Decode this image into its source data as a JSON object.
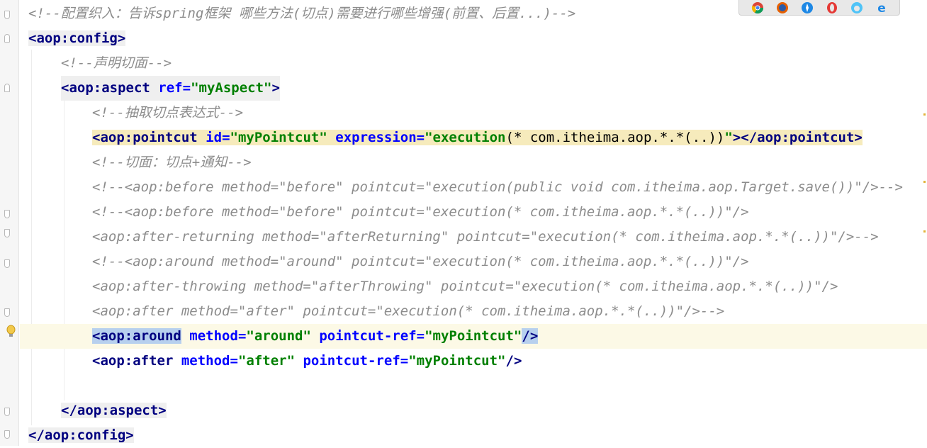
{
  "browser_icons": [
    "chrome-icon",
    "firefox-icon",
    "safari-icon",
    "opera-icon",
    "edge-icon",
    "ie-icon"
  ],
  "lines": [
    {
      "kind": "comment",
      "text": "<!--配置织入：告诉spring框架 哪些方法(切点)需要进行哪些增强(前置、后置...)-->"
    },
    {
      "kind": "open",
      "open": "<aop:config>"
    },
    {
      "kind": "comment",
      "text": "<!--声明切面-->"
    },
    {
      "kind": "tag",
      "lt": "<",
      "name": "aop:aspect",
      "attrs": [
        {
          "n": "ref",
          "v": "\"myAspect\""
        }
      ],
      "close": ">"
    },
    {
      "kind": "comment",
      "text": "<!--抽取切点表达式-->"
    },
    {
      "kind": "pointcut",
      "lt": "<",
      "name": "aop:pointcut",
      "id_attr": "id",
      "id_val": "\"myPointcut\"",
      "expr_attr": "expression",
      "expr_val_1": "\"execution",
      "expr_val_2": "(* com.itheima.aop.*.*(..))",
      "expr_val_3": "\"",
      "close": "></aop:pointcut>"
    },
    {
      "kind": "comment",
      "text": "<!--切面：切点+通知-->"
    },
    {
      "kind": "comment",
      "text": "<!--<aop:before method=\"before\" pointcut=\"execution(public void com.itheima.aop.Target.save())\"/>-->"
    },
    {
      "kind": "comment",
      "text": "<!--<aop:before method=\"before\" pointcut=\"execution(* com.itheima.aop.*.*(..))\"/>"
    },
    {
      "kind": "comment",
      "text": "<aop:after-returning method=\"afterReturning\" pointcut=\"execution(* com.itheima.aop.*.*(..))\"/>-->"
    },
    {
      "kind": "comment",
      "text": "<!--<aop:around method=\"around\" pointcut=\"execution(* com.itheima.aop.*.*(..))\"/>"
    },
    {
      "kind": "comment",
      "text": "<aop:after-throwing method=\"afterThrowing\" pointcut=\"execution(* com.itheima.aop.*.*(..))\"/>"
    },
    {
      "kind": "comment",
      "text": "<aop:after method=\"after\" pointcut=\"execution(* com.itheima.aop.*.*(..))\"/>-->"
    },
    {
      "kind": "tagline",
      "lt": "<",
      "name": "aop:around",
      "attrs": [
        {
          "n": "method",
          "v": "\"around\""
        },
        {
          "n": "pointcut-ref",
          "v": "\"myPointcut\""
        }
      ],
      "close": "/>"
    },
    {
      "kind": "tagline",
      "lt": "<",
      "name": "aop:after",
      "attrs": [
        {
          "n": "method",
          "v": "\"after\""
        },
        {
          "n": "pointcut-ref",
          "v": "\"myPointcut\""
        }
      ],
      "close": "/>"
    },
    {
      "kind": "blank",
      "text": ""
    },
    {
      "kind": "close",
      "text": "</aop:aspect>"
    },
    {
      "kind": "close",
      "text": "</aop:config>"
    }
  ],
  "colors": {
    "comment": "#8c8c8c",
    "tag": "#000080",
    "attr": "#0000ff",
    "value": "#008000",
    "current_line": "#fcf9e6",
    "selection": "#b7d0ee",
    "pointcut_highlight": "#f6ebbc"
  }
}
